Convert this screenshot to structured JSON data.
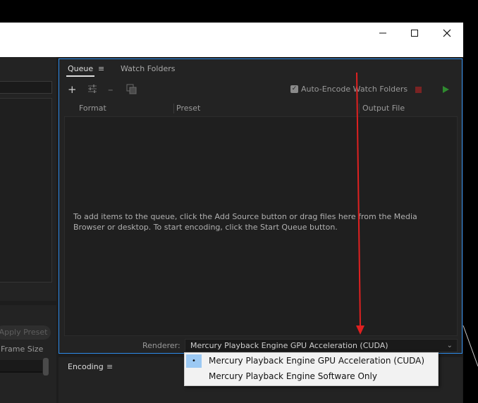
{
  "window": {
    "minimize_icon": "minimize-icon",
    "maximize_icon": "maximize-icon",
    "close_icon": "close-icon"
  },
  "left_panel": {
    "apply_preset_label": "Apply Preset",
    "frame_size_label": "Frame Size"
  },
  "queue_panel": {
    "tabs": [
      {
        "label": "Queue",
        "active": true
      },
      {
        "label": "Watch Folders",
        "active": false
      }
    ],
    "menu_icon": "≡",
    "toolbar": {
      "add_icon": "+",
      "settings_icon": "sliders-icon",
      "remove_icon": "–",
      "duplicate_icon": "duplicate-icon"
    },
    "auto_encode": {
      "label": "Auto-Encode Watch Folders",
      "checked": true
    },
    "columns": [
      "Format",
      "Preset",
      "Output File"
    ],
    "empty_message": "To add items to the queue, click the Add Source button or drag files here from the Media Browser or desktop.  To start encoding, click the Start Queue button.",
    "renderer": {
      "label": "Renderer:",
      "value": "Mercury Playback Engine GPU Acceleration (CUDA)"
    }
  },
  "encoding_panel": {
    "tab_label": "Encoding",
    "menu_icon": "≡"
  },
  "renderer_dropdown": {
    "options": [
      {
        "label": "Mercury Playback Engine GPU Acceleration (CUDA)",
        "selected": true
      },
      {
        "label": "Mercury Playback Engine Software Only",
        "selected": false
      }
    ],
    "selected_mark": "•"
  },
  "colors": {
    "accent": "#2d8ceb",
    "annotation_arrow": "#e02020",
    "stop": "#7a2323",
    "start": "#2f8a2f",
    "selection": "#9cc9f3"
  }
}
